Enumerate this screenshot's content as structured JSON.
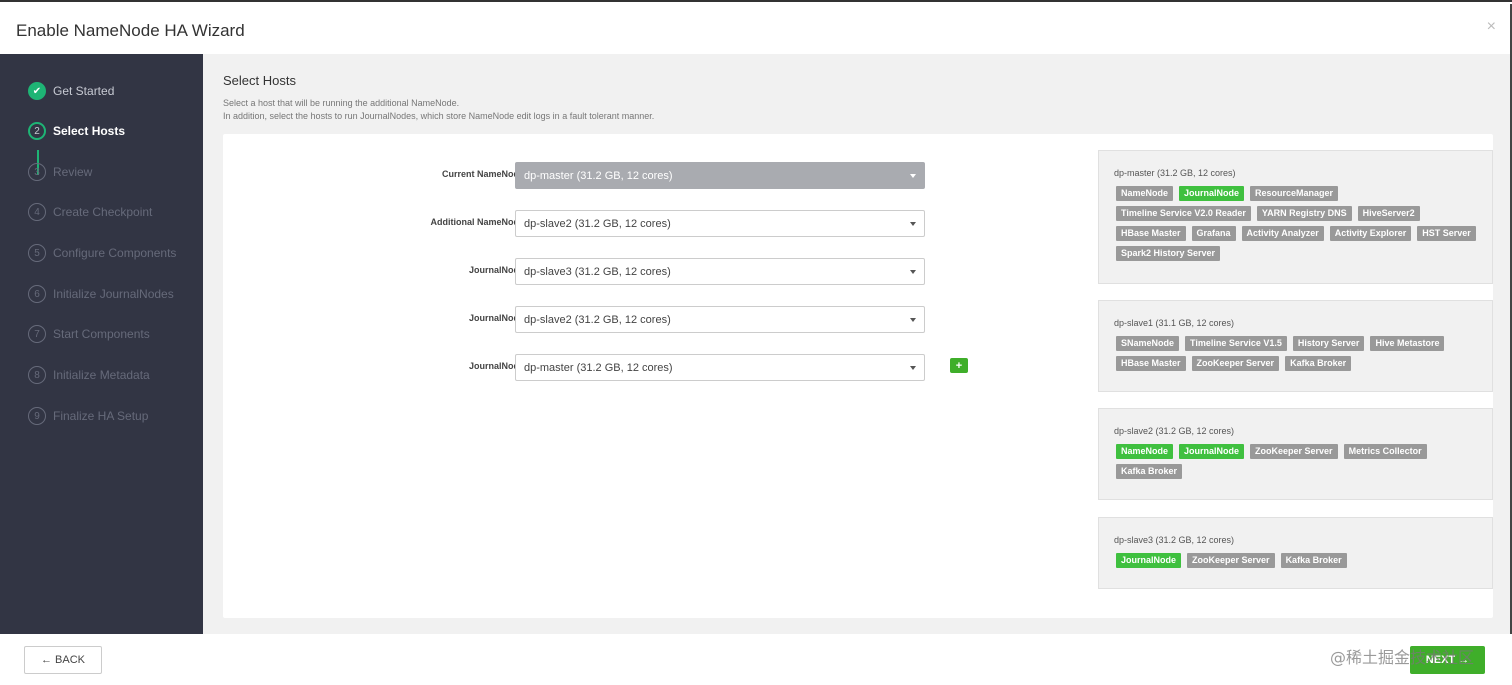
{
  "dialog": {
    "title": "Enable NameNode HA Wizard",
    "close_glyph": "×"
  },
  "steps": [
    {
      "number": "✔",
      "label": "Get Started",
      "state": "done"
    },
    {
      "number": "2",
      "label": "Select Hosts",
      "state": "active"
    },
    {
      "number": "3",
      "label": "Review",
      "state": "pending"
    },
    {
      "number": "4",
      "label": "Create Checkpoint",
      "state": "pending"
    },
    {
      "number": "5",
      "label": "Configure Components",
      "state": "pending"
    },
    {
      "number": "6",
      "label": "Initialize JournalNodes",
      "state": "pending"
    },
    {
      "number": "7",
      "label": "Start Components",
      "state": "pending"
    },
    {
      "number": "8",
      "label": "Initialize Metadata",
      "state": "pending"
    },
    {
      "number": "9",
      "label": "Finalize HA Setup",
      "state": "pending"
    }
  ],
  "main": {
    "title": "Select Hosts",
    "desc_line1": "Select a host that will be running the additional NameNode.",
    "desc_line2": "In addition, select the hosts to run JournalNodes, which store NameNode edit logs in a fault tolerant manner."
  },
  "assignments": [
    {
      "label": "Current NameNode:",
      "value": "dp-master (31.2 GB, 12 cores)",
      "disabled": true
    },
    {
      "label": "Additional NameNode:",
      "value": "dp-slave2 (31.2 GB, 12 cores)",
      "disabled": false
    },
    {
      "label": "JournalNode:",
      "value": "dp-slave3 (31.2 GB, 12 cores)",
      "disabled": false
    },
    {
      "label": "JournalNode:",
      "value": "dp-slave2 (31.2 GB, 12 cores)",
      "disabled": false
    },
    {
      "label": "JournalNode:",
      "value": "dp-master (31.2 GB, 12 cores)",
      "disabled": false
    }
  ],
  "add_button_label": "+",
  "hosts": [
    {
      "name": "dp-master (31.2 GB, 12 cores)",
      "components": [
        {
          "label": "NameNode",
          "highlight": false
        },
        {
          "label": "JournalNode",
          "highlight": true
        },
        {
          "label": "ResourceManager",
          "highlight": false
        },
        {
          "label": "Timeline Service V2.0 Reader",
          "highlight": false
        },
        {
          "label": "YARN Registry DNS",
          "highlight": false
        },
        {
          "label": "HiveServer2",
          "highlight": false
        },
        {
          "label": "HBase Master",
          "highlight": false
        },
        {
          "label": "Grafana",
          "highlight": false
        },
        {
          "label": "Activity Analyzer",
          "highlight": false
        },
        {
          "label": "Activity Explorer",
          "highlight": false
        },
        {
          "label": "HST Server",
          "highlight": false
        },
        {
          "label": "Spark2 History Server",
          "highlight": false
        }
      ]
    },
    {
      "name": "dp-slave1 (31.1 GB, 12 cores)",
      "components": [
        {
          "label": "SNameNode",
          "highlight": false
        },
        {
          "label": "Timeline Service V1.5",
          "highlight": false
        },
        {
          "label": "History Server",
          "highlight": false
        },
        {
          "label": "Hive Metastore",
          "highlight": false
        },
        {
          "label": "HBase Master",
          "highlight": false
        },
        {
          "label": "ZooKeeper Server",
          "highlight": false
        },
        {
          "label": "Kafka Broker",
          "highlight": false
        }
      ]
    },
    {
      "name": "dp-slave2 (31.2 GB, 12 cores)",
      "components": [
        {
          "label": "NameNode",
          "highlight": true
        },
        {
          "label": "JournalNode",
          "highlight": true
        },
        {
          "label": "ZooKeeper Server",
          "highlight": false
        },
        {
          "label": "Metrics Collector",
          "highlight": false
        },
        {
          "label": "Kafka Broker",
          "highlight": false
        }
      ]
    },
    {
      "name": "dp-slave3 (31.2 GB, 12 cores)",
      "components": [
        {
          "label": "JournalNode",
          "highlight": true
        },
        {
          "label": "ZooKeeper Server",
          "highlight": false
        },
        {
          "label": "Kafka Broker",
          "highlight": false
        }
      ]
    }
  ],
  "footer": {
    "back_label": "← BACK",
    "next_label": "NEXT →",
    "watermark": "@稀土掘金技术社区"
  },
  "colors": {
    "sidebar_bg": "#323544",
    "accent_green": "#1eb475",
    "badge_green": "#3fc03f",
    "badge_gray": "#999999"
  }
}
